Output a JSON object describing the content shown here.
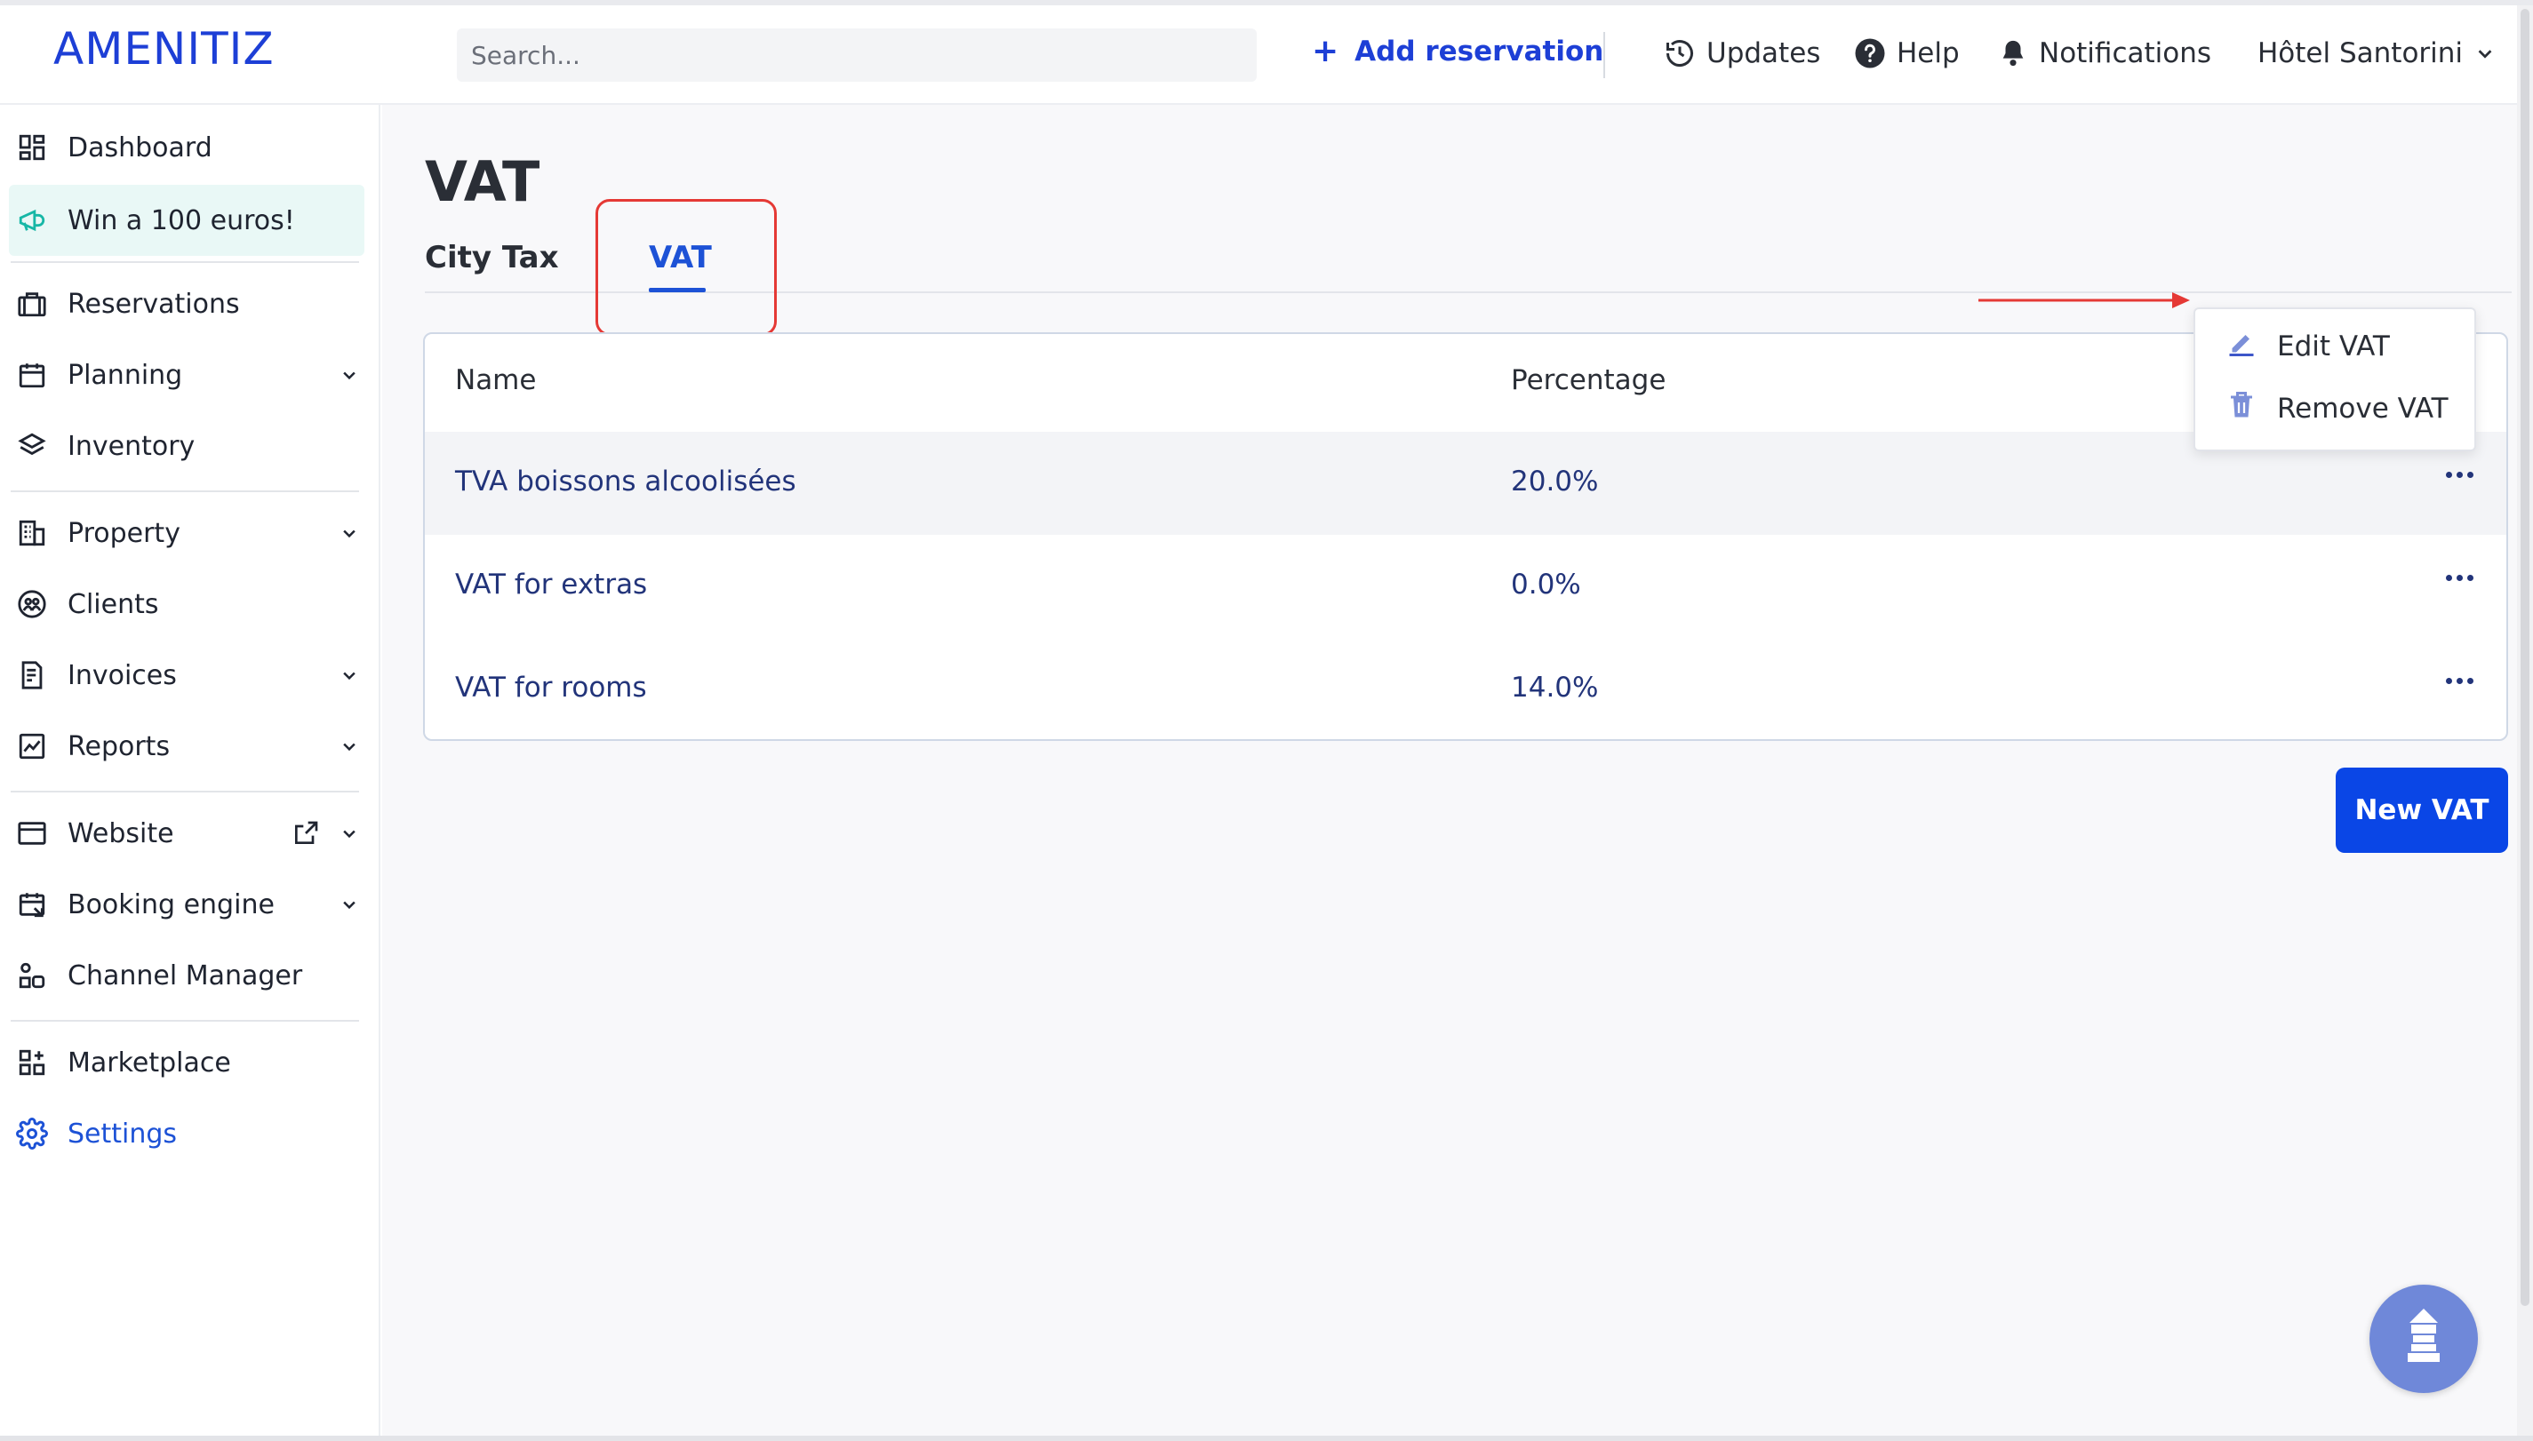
{
  "header": {
    "logo": "AMENITIZ",
    "search_placeholder": "Search...",
    "add_reservation": "Add reservation",
    "updates": "Updates",
    "help": "Help",
    "notifications": "Notifications",
    "property_name": "Hôtel Santorini"
  },
  "sidebar": {
    "items": [
      {
        "label": "Dashboard",
        "icon": "dashboard-icon"
      },
      {
        "label": "Win a 100 euros!",
        "icon": "megaphone-icon"
      },
      {
        "label": "Reservations",
        "icon": "briefcase-icon"
      },
      {
        "label": "Planning",
        "icon": "calendar-icon"
      },
      {
        "label": "Inventory",
        "icon": "layers-icon"
      },
      {
        "label": "Property",
        "icon": "building-icon"
      },
      {
        "label": "Clients",
        "icon": "clients-icon"
      },
      {
        "label": "Invoices",
        "icon": "invoice-icon"
      },
      {
        "label": "Reports",
        "icon": "chart-icon"
      },
      {
        "label": "Website",
        "icon": "browser-icon"
      },
      {
        "label": "Booking engine",
        "icon": "booking-icon"
      },
      {
        "label": "Channel Manager",
        "icon": "channel-icon"
      },
      {
        "label": "Marketplace",
        "icon": "marketplace-icon"
      },
      {
        "label": "Settings",
        "icon": "gear-icon"
      }
    ]
  },
  "main": {
    "title": "VAT",
    "tabs": [
      {
        "label": "City Tax",
        "active": false
      },
      {
        "label": "VAT",
        "active": true
      }
    ],
    "table": {
      "columns": [
        "Name",
        "Percentage"
      ],
      "rows": [
        {
          "name": "TVA boissons alcoolisées",
          "percentage": "20.0%"
        },
        {
          "name": "VAT for extras",
          "percentage": "0.0%"
        },
        {
          "name": "VAT for rooms",
          "percentage": "14.0%"
        }
      ]
    },
    "row_menu": {
      "edit": "Edit VAT",
      "remove": "Remove VAT"
    },
    "new_button": "New VAT"
  },
  "colors": {
    "brand": "#1d3fd6",
    "active": "#1d52d6",
    "primary_button": "#0a46e6",
    "annotation": "#e53935",
    "promo_bg": "#e9f8f6"
  }
}
